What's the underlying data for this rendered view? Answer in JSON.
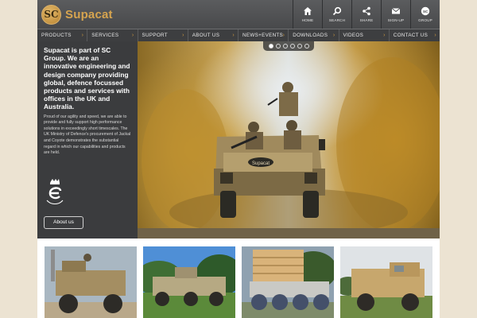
{
  "header": {
    "logo_mark": "SC",
    "logo_text": "Supacat",
    "icons": [
      {
        "icon": "home-icon",
        "label": "HOME"
      },
      {
        "icon": "search-icon",
        "label": "SEARCH"
      },
      {
        "icon": "share-icon",
        "label": "SHARE"
      },
      {
        "icon": "mail-icon",
        "label": "SIGN-UP"
      },
      {
        "icon": "group-icon",
        "label": "GROUP"
      }
    ]
  },
  "nav": {
    "items": [
      {
        "label": "PRODUCTS"
      },
      {
        "label": "SERVICES"
      },
      {
        "label": "SUPPORT"
      },
      {
        "label": "ABOUT US"
      },
      {
        "label": "NEWS+EVENTS"
      },
      {
        "label": "DOWNLOADS"
      },
      {
        "label": "VIDEOS"
      },
      {
        "label": "CONTACT US"
      }
    ],
    "chevron": "›"
  },
  "intro": {
    "heading": "Supacat is part of SC Group. We are an innovative engineering and design company providing global, defence focussed products and services with offices in the UK and Australia.",
    "body": "Proud of our agility and speed, we are able to provide and fully support high performance solutions in exceedingly short timescales. The UK Ministry of Defence's procurement of Jackal and Coyote demonstrates the substantial regard in which our capabilities and products are held.",
    "about_button": "About us"
  },
  "hero": {
    "vehicle_badge": "Supacat",
    "slides_total": 6,
    "active_slide": 1
  },
  "colors": {
    "accent": "#c9953f",
    "header": "#505153",
    "nav": "#3d3e40",
    "panel": "#3b3c3e",
    "page_background": "#ece3d2"
  }
}
